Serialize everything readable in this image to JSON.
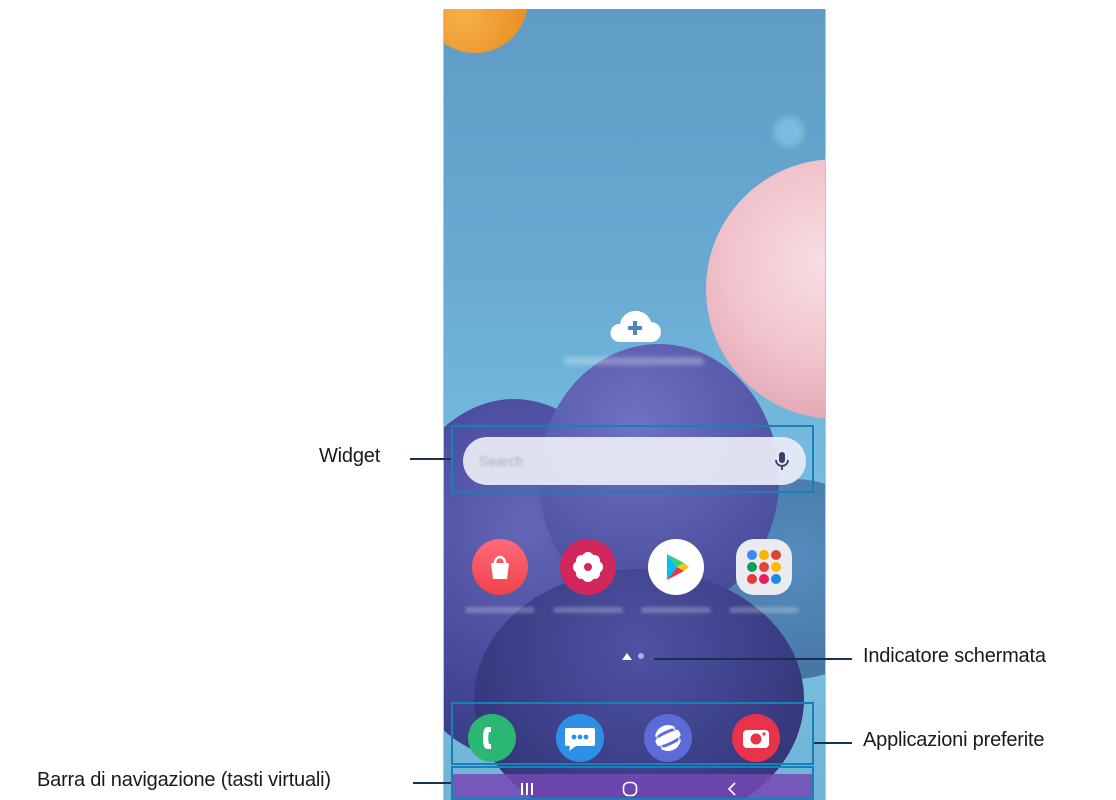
{
  "callouts": {
    "widget": "Widget",
    "screen_indicator": "Indicatore schermata",
    "favorite_apps": "Applicazioni preferite",
    "navigation_bar": "Barra di navigazione (tasti virtuali)"
  },
  "home": {
    "search_placeholder": "Search",
    "apps": [
      {
        "icon": "galaxy-store-icon",
        "color": "#f24f3f"
      },
      {
        "icon": "gallery-icon",
        "color": "#d2275d"
      },
      {
        "icon": "play-store-icon",
        "color": "#ffffff"
      },
      {
        "icon": "google-folder-icon",
        "color": "#e9ebf1"
      }
    ],
    "page_indicator": {
      "pages": 2,
      "current": 1
    },
    "dock": [
      {
        "icon": "phone-icon",
        "color": "#2bb673"
      },
      {
        "icon": "messages-icon",
        "color": "#2f8fe4"
      },
      {
        "icon": "internet-icon",
        "color": "#5c6bd8"
      },
      {
        "icon": "camera-icon",
        "color": "#e8334b"
      }
    ],
    "navigation": [
      {
        "icon": "recent-apps-icon"
      },
      {
        "icon": "home-icon"
      },
      {
        "icon": "back-icon"
      }
    ]
  },
  "colors": {
    "callout_border": "#1a7fb8",
    "navbar": "#7548b5"
  }
}
